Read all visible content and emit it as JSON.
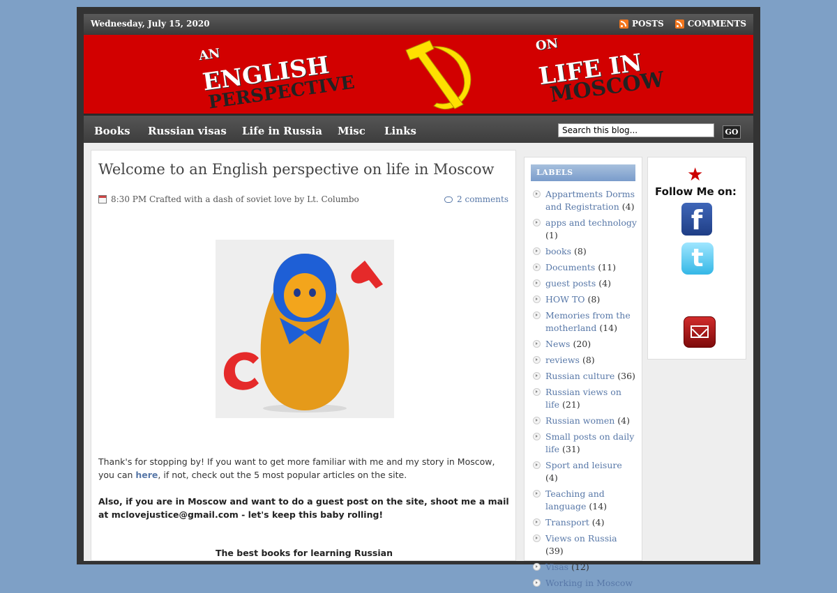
{
  "topbar": {
    "date": "Wednesday, July 15, 2020",
    "posts": "Posts",
    "comments": "Comments"
  },
  "banner": {
    "t1": "AN",
    "t2": "ENGLISH",
    "t3": "PERSPECTIVE",
    "t4": "ON",
    "t5": "LIFE IN",
    "t6": "MOSCOW"
  },
  "nav": {
    "items": [
      "Books",
      "Russian visas",
      "Life in Russia",
      "Misc",
      "Links"
    ],
    "search_value": "Search this blog...",
    "go": "GO"
  },
  "post": {
    "title": "Welcome to an English perspective on life in Moscow",
    "meta": "8:30 PM Crafted with a dash of soviet love by Lt. Columbo",
    "comments": "2 comments",
    "p1_before": "Thank's for stopping by! If you want to get more familiar with me and my story in Moscow, you can ",
    "p1_link": "here",
    "p1_after": ", if not, check out the 5 most popular articles on the site.",
    "p2": "Also, if you are in Moscow and want to do a guest post on the site, shoot me a mail at mclovejustice@gmail.com - let's keep this baby rolling!",
    "p3": "The best books for learning Russian"
  },
  "labels": {
    "title": "LABELS",
    "items": [
      {
        "name": "Appartments Dorms and Registration",
        "count": "(4)"
      },
      {
        "name": "apps and technology",
        "count": "(1)"
      },
      {
        "name": "books",
        "count": "(8)"
      },
      {
        "name": "Documents",
        "count": "(11)"
      },
      {
        "name": "guest posts",
        "count": "(4)"
      },
      {
        "name": "HOW TO",
        "count": "(8)"
      },
      {
        "name": "Memories from the motherland",
        "count": "(14)"
      },
      {
        "name": "News",
        "count": "(20)"
      },
      {
        "name": "reviews",
        "count": "(8)"
      },
      {
        "name": "Russian culture",
        "count": "(36)"
      },
      {
        "name": "Russian views on life",
        "count": "(21)"
      },
      {
        "name": "Russian women",
        "count": "(4)"
      },
      {
        "name": "Small posts on daily life",
        "count": "(31)"
      },
      {
        "name": "Sport and leisure",
        "count": "(4)"
      },
      {
        "name": "Teaching and language",
        "count": "(14)"
      },
      {
        "name": "Transport",
        "count": "(4)"
      },
      {
        "name": "Views on Russia",
        "count": "(39)"
      },
      {
        "name": "Visas",
        "count": "(12)"
      },
      {
        "name": "Working in Moscow",
        "count": ""
      }
    ]
  },
  "follow": {
    "text": "Follow Me on:",
    "fb": "f",
    "tw": "t"
  }
}
